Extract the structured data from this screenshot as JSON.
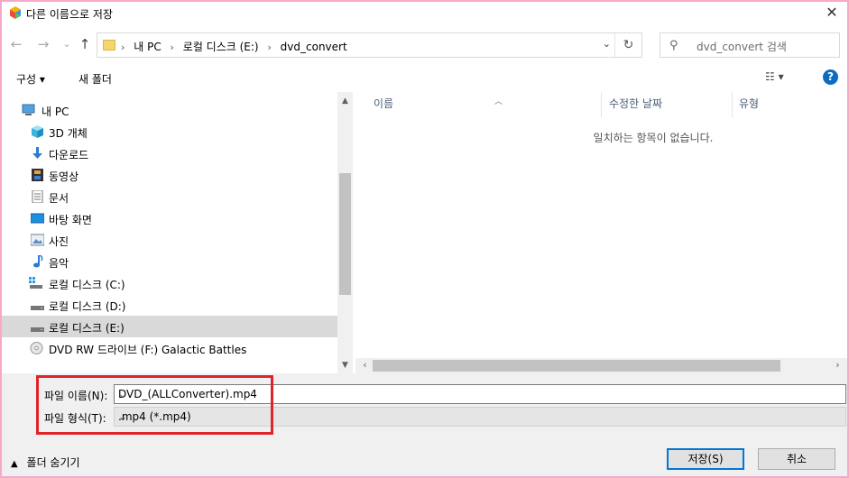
{
  "window": {
    "title": "다른 이름으로 저장",
    "close": "✕"
  },
  "nav": {
    "back": "←",
    "forward": "→",
    "recent": "⌄",
    "up": "↑",
    "breadcrumb": [
      "내 PC",
      "로컬 디스크 (E:)",
      "dvd_convert"
    ],
    "sep": "›",
    "dropdown": "⌄",
    "refresh": "↻",
    "search_placeholder": "dvd_convert 검색"
  },
  "toolbar": {
    "organize": "구성 ▾",
    "new_folder": "새 폴더",
    "view": "☷ ▾",
    "help": "?"
  },
  "sidebar": {
    "items": [
      {
        "label": "내 PC",
        "icon": "pc-icon"
      },
      {
        "label": "3D 개체",
        "icon": "3d-objects-icon"
      },
      {
        "label": "다운로드",
        "icon": "download-icon"
      },
      {
        "label": "동영상",
        "icon": "videos-icon"
      },
      {
        "label": "문서",
        "icon": "documents-icon"
      },
      {
        "label": "바탕 화면",
        "icon": "desktop-icon"
      },
      {
        "label": "사진",
        "icon": "pictures-icon"
      },
      {
        "label": "음악",
        "icon": "music-icon"
      },
      {
        "label": "로컬 디스크 (C:)",
        "icon": "drive-c-icon"
      },
      {
        "label": "로컬 디스크 (D:)",
        "icon": "drive-d-icon"
      },
      {
        "label": "로컬 디스크 (E:)",
        "icon": "drive-e-icon",
        "selected": true
      },
      {
        "label": "DVD RW 드라이브 (F:) Galactic Battles",
        "icon": "dvd-drive-icon"
      }
    ]
  },
  "filelist": {
    "columns": [
      "이름",
      "수정한 날짜",
      "유형"
    ],
    "empty_message": "일치하는 항목이 없습니다."
  },
  "form": {
    "filename_label": "파일 이름(N):",
    "filename_value": "DVD_(ALLConverter).mp4",
    "filetype_label": "파일 형식(T):",
    "filetype_value": ".mp4 (*.mp4)",
    "hide_folders": "폴더 숨기기",
    "save": "저장(S)",
    "cancel": "취소"
  },
  "colors": {
    "highlight": "#e0242a",
    "accent": "#0078d7",
    "frame": "#f5a9c8"
  }
}
